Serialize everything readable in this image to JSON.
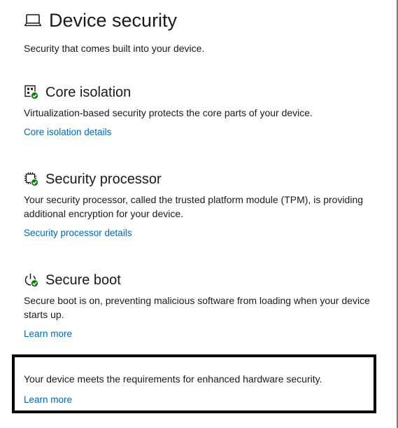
{
  "header": {
    "title": "Device security",
    "subtitle": "Security that comes built into your device.",
    "icon": "laptop-icon"
  },
  "sections": [
    {
      "title": "Core isolation",
      "description": "Virtualization-based security protects the core parts of your device.",
      "link": "Core isolation details",
      "icon": "core-isolation-icon",
      "status": "ok"
    },
    {
      "title": "Security processor",
      "description": "Your security processor, called the trusted platform module (TPM), is providing additional encryption for your device.",
      "link": "Security processor details",
      "icon": "chip-icon",
      "status": "ok"
    },
    {
      "title": "Secure boot",
      "description": "Secure boot is on, preventing malicious software from loading when your device starts up.",
      "link": "Learn more",
      "icon": "power-icon",
      "status": "ok"
    }
  ],
  "status_box": {
    "text": "Your device meets the requirements for enhanced hardware security.",
    "link": "Learn more"
  },
  "colors": {
    "link": "#0067b8",
    "ok_badge": "#107c10",
    "text": "#1a1a1a",
    "box_border": "#000000"
  }
}
